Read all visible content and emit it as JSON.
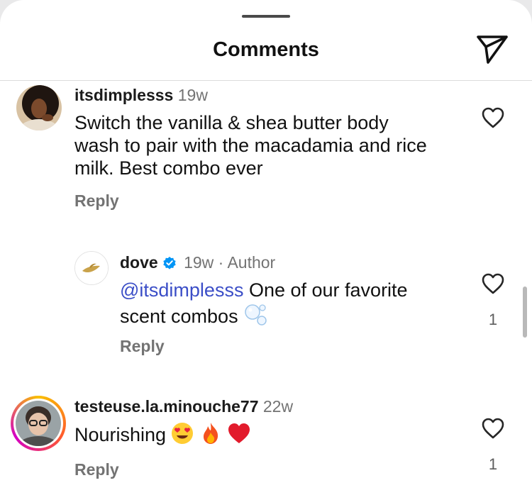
{
  "sheet": {
    "title": "Comments"
  },
  "comments": [
    {
      "username": "itsdimplesss",
      "time": "19w",
      "text": "Switch the vanilla & shea butter body wash to pair with the macadamia and rice milk. Best combo ever",
      "reply_label": "Reply"
    },
    {
      "username": "dove",
      "time": "19w · Author",
      "mention": "@itsdimplesss",
      "text_line1": " One of our favorite",
      "text_line2": "scent combos",
      "reply_label": "Reply",
      "likes": "1"
    },
    {
      "username": "testeuse.la.minouche77",
      "time": "22w",
      "text": "Nourishing",
      "reply_label": "Reply",
      "likes": "1"
    }
  ],
  "colors": {
    "mention": "#3b4ec7",
    "verified": "#0095f6",
    "story_ring_start": "#f9c000",
    "story_ring_end": "#c000c8"
  },
  "icons": [
    "send-icon",
    "heart-icon",
    "verified-badge-icon",
    "bubbles-emoji",
    "heart-eyes-emoji",
    "fire-emoji",
    "red-heart-emoji"
  ]
}
